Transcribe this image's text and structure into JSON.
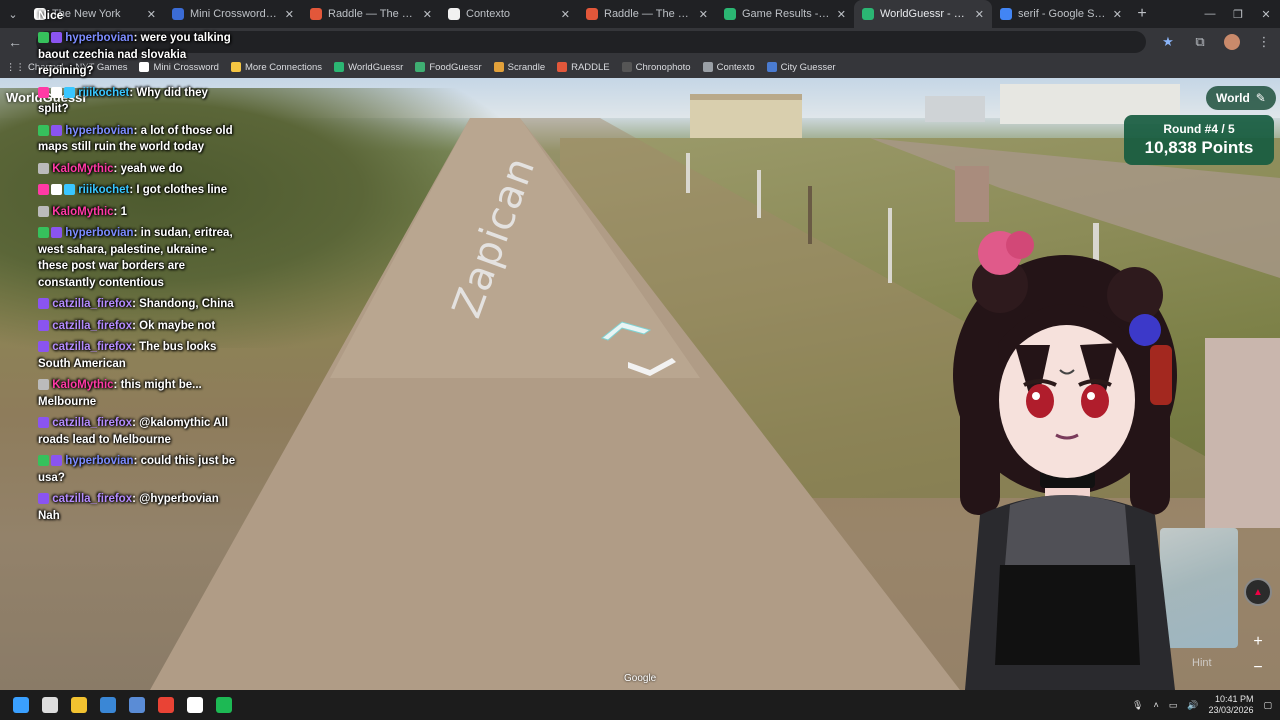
{
  "browser": {
    "tabs": [
      {
        "title": "The New York",
        "color": "#ffffff",
        "active": false
      },
      {
        "title": "Mini Crossword - Los Ange",
        "color": "#3b6cd6",
        "active": false
      },
      {
        "title": "Raddle — The Word Trans",
        "color": "#e2573a",
        "active": false
      },
      {
        "title": "Contexto",
        "color": "#f1f1f1",
        "active": false
      },
      {
        "title": "Raddle — The Word Trans",
        "color": "#e2573a",
        "active": false
      },
      {
        "title": "Game Results - FoodGuess",
        "color": "#2bb673",
        "active": false
      },
      {
        "title": "WorldGuessr - Play Geogra",
        "color": "#2bb673",
        "active": true
      },
      {
        "title": "serif - Google Search",
        "color": "#4285f4",
        "active": false
      }
    ],
    "bookmarks": [
      {
        "label": "Mini Crossword",
        "color": "#ffffff"
      },
      {
        "label": "More Connections",
        "color": "#f4c542"
      },
      {
        "label": "WorldGuessr",
        "color": "#2bb673"
      },
      {
        "label": "FoodGuessr",
        "color": "#3fae72"
      },
      {
        "label": "Scrandle",
        "color": "#e2a13a"
      },
      {
        "label": "RADDLE",
        "color": "#e2573a"
      },
      {
        "label": "Chronophoto",
        "color": "#555555"
      },
      {
        "label": "Contexto",
        "color": "#9aa0a6"
      },
      {
        "label": "City Guesser",
        "color": "#4a7bd0"
      }
    ],
    "bookmark_partial": [
      "Channel",
      "NYT Games"
    ]
  },
  "overlay": {
    "top_text": "Nice",
    "title_text": "WorldGuessr",
    "google": "Google"
  },
  "chat": [
    {
      "user": "hyperbovian",
      "userClass": "u-hyper",
      "badges": [
        "#36c15c",
        "#8a54f0"
      ],
      "text": "were you talking baout czechia nad slovakia rejoining?"
    },
    {
      "user": "riiikochet",
      "userClass": "u-riii",
      "badges": [
        "#ff3aa5",
        "#ffffff",
        "#39c7ff"
      ],
      "text": "Why did they split?"
    },
    {
      "user": "hyperbovian",
      "userClass": "u-hyper",
      "badges": [
        "#36c15c",
        "#8a54f0"
      ],
      "text": "a lot of those old maps still ruin the world today"
    },
    {
      "user": "KaloMythic",
      "userClass": "u-kalo",
      "badges": [
        "#bbbbbb"
      ],
      "text": "yeah we do"
    },
    {
      "user": "riiikochet",
      "userClass": "u-riii",
      "badges": [
        "#ff3aa5",
        "#ffffff",
        "#39c7ff"
      ],
      "text": "I got clothes line"
    },
    {
      "user": "KaloMythic",
      "userClass": "u-kalo",
      "badges": [
        "#bbbbbb"
      ],
      "text": "1"
    },
    {
      "user": "hyperbovian",
      "userClass": "u-hyper",
      "badges": [
        "#36c15c",
        "#8a54f0"
      ],
      "text": "in sudan, eritrea, west sahara, palestine, ukraine - these post war borders are constantly contentious"
    },
    {
      "user": "catzilla_firefox",
      "userClass": "u-catz",
      "badges": [
        "#8a54f0"
      ],
      "text": "Shandong, China"
    },
    {
      "user": "catzilla_firefox",
      "userClass": "u-catz",
      "badges": [
        "#8a54f0"
      ],
      "text": "Ok maybe not"
    },
    {
      "user": "catzilla_firefox",
      "userClass": "u-catz",
      "badges": [
        "#8a54f0"
      ],
      "text": "The bus looks South American"
    },
    {
      "user": "KaloMythic",
      "userClass": "u-kalo",
      "badges": [
        "#bbbbbb"
      ],
      "text": "this might be... Melbourne"
    },
    {
      "user": "catzilla_firefox",
      "userClass": "u-catz",
      "badges": [
        "#8a54f0"
      ],
      "text": "@kalomythic All roads lead to Melbourne"
    },
    {
      "user": "hyperbovian",
      "userClass": "u-hyper",
      "badges": [
        "#36c15c",
        "#8a54f0"
      ],
      "text": "could this just be usa?"
    },
    {
      "user": "catzilla_firefox",
      "userClass": "u-catz",
      "badges": [
        "#8a54f0"
      ],
      "text": "@hyperbovian Nah"
    }
  ],
  "game": {
    "mode": "World",
    "round": "Round #4 / 5",
    "points": "10,838 Points",
    "hint": "Hint",
    "road_label": "Zapican"
  },
  "taskbar": {
    "time": "10:41 PM",
    "date": "23/03/2026",
    "apps": [
      {
        "name": "windows-start",
        "color": "#3aa0ff"
      },
      {
        "name": "obs",
        "color": "#ddd"
      },
      {
        "name": "file-explorer",
        "color": "#f2c230"
      },
      {
        "name": "photos",
        "color": "#3a87d6"
      },
      {
        "name": "vtuber-studio",
        "color": "#5a8cd6"
      },
      {
        "name": "chrome",
        "color": "#e94335"
      },
      {
        "name": "capcut",
        "color": "#ffffff"
      },
      {
        "name": "spotify",
        "color": "#1db954"
      }
    ]
  },
  "colors": {
    "accent": "#175c40",
    "chat_hyper": "#7c8cff",
    "chat_catzilla": "#b58cff",
    "chat_kalo": "#ff3aa5",
    "chat_riii": "#39c7ff"
  }
}
